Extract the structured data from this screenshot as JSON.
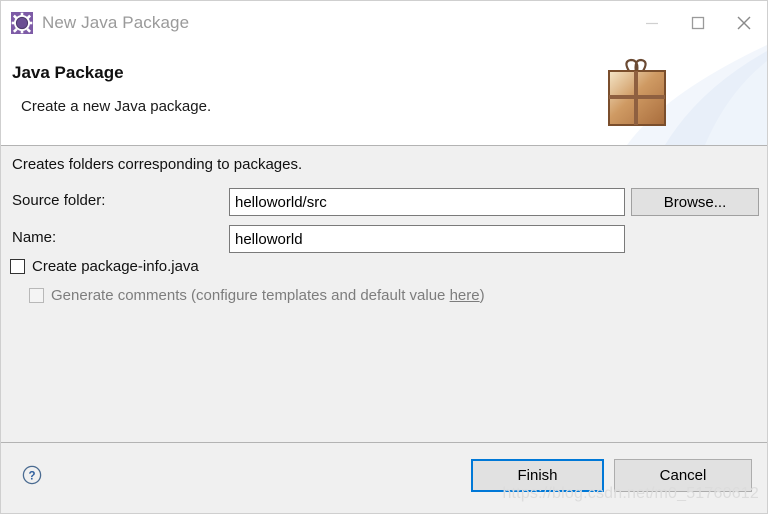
{
  "window": {
    "title": "New Java Package",
    "icon": "java-package-gear-icon",
    "controls": {
      "minimize": "minimize-icon",
      "maximize": "maximize-icon",
      "close": "close-icon"
    }
  },
  "header": {
    "title": "Java Package",
    "subtitle": "Create a new Java package.",
    "banner_icon": "gift-package-icon"
  },
  "body": {
    "intro": "Creates folders corresponding to packages.",
    "fields": [
      {
        "label": "Source folder:",
        "value": "helloworld/src",
        "placeholder": "",
        "button": "Browse..."
      },
      {
        "label": "Name:",
        "value": "helloworld",
        "placeholder": ""
      }
    ],
    "checkboxes": [
      {
        "label": "Create package-info.java",
        "checked": false,
        "disabled": false
      },
      {
        "label_before": "Generate comments (configure templates and default value ",
        "link": "here",
        "label_after": ")",
        "checked": false,
        "disabled": true
      }
    ]
  },
  "footer": {
    "help": "?",
    "finish_label": "Finish",
    "cancel_label": "Cancel"
  },
  "watermark": "https://blog.csdn.net/m0_51760612",
  "colors": {
    "accent": "#0078d7",
    "dialog_bg": "#f0f0f0",
    "header_bg": "#ffffff",
    "title_text": "#9a9a9a",
    "disabled_text": "#7d7d7d"
  }
}
